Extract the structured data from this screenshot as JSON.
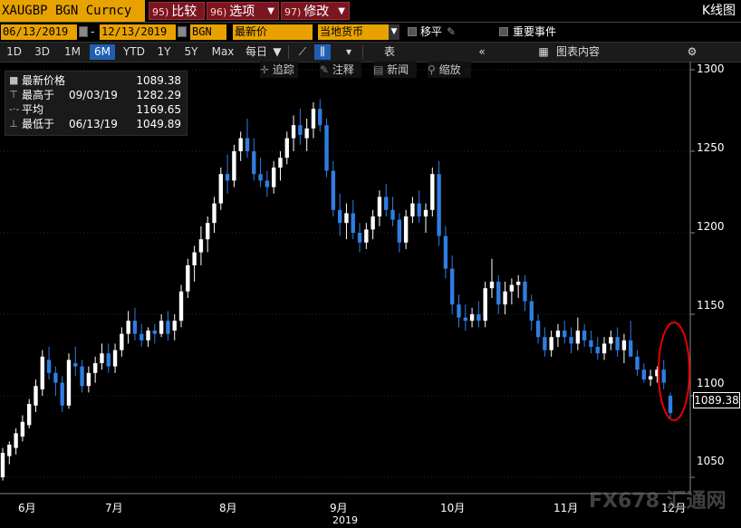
{
  "toolbar": {
    "ticker": "XAUGBP BGN Curncy",
    "menu": [
      {
        "num": "95)",
        "label": "比较"
      },
      {
        "num": "96)",
        "label": "选项"
      },
      {
        "num": "97)",
        "label": "修改"
      }
    ],
    "window_title": "K线图"
  },
  "controls": {
    "start_date": "06/13/2019",
    "end_date": "12/13/2019",
    "date_sep": "-",
    "source": "BGN",
    "price_field": "最新价",
    "currency": "当地货币",
    "move_label": "移平",
    "events_label": "重要事件"
  },
  "periods": {
    "items": [
      "1D",
      "3D",
      "1M",
      "6M",
      "YTD",
      "1Y",
      "5Y",
      "Max"
    ],
    "active": "6M",
    "interval": "每日",
    "table_label": "表",
    "chart_content_label": "图表内容"
  },
  "tools": [
    "追踪",
    "注释",
    "新闻",
    "缩放"
  ],
  "legend": {
    "rows": [
      {
        "icon": "square-icon",
        "label": "最新价格",
        "date": "",
        "value": "1089.38"
      },
      {
        "icon": "high-icon",
        "label": "最高于",
        "date": "09/03/19",
        "value": "1282.29"
      },
      {
        "icon": "avg-icon",
        "label": "平均",
        "date": "",
        "value": "1169.65"
      },
      {
        "icon": "low-icon",
        "label": "最低于",
        "date": "06/13/19",
        "value": "1049.89"
      }
    ]
  },
  "colors": {
    "up": "#ffffff",
    "down": "#2f7de1",
    "accent": "#e8a200",
    "menu": "#7a1620",
    "annotation": "#e60000"
  },
  "watermark": "FX678 汇通网",
  "chart_data": {
    "type": "candlestick",
    "x_labels": [
      "6月",
      "7月",
      "8月",
      "9月",
      "10月",
      "11月",
      "12月"
    ],
    "year_label": "2019",
    "y_ticks": [
      1050,
      1100,
      1150,
      1200,
      1250,
      1300
    ],
    "ylim": [
      1040,
      1305
    ],
    "last_price": "1089.38",
    "candles": [
      [
        1050,
        1068,
        1048,
        1065
      ],
      [
        1063,
        1072,
        1058,
        1070
      ],
      [
        1068,
        1080,
        1064,
        1077
      ],
      [
        1075,
        1088,
        1072,
        1084
      ],
      [
        1082,
        1098,
        1080,
        1095
      ],
      [
        1094,
        1110,
        1090,
        1106
      ],
      [
        1104,
        1128,
        1100,
        1124
      ],
      [
        1122,
        1130,
        1110,
        1114
      ],
      [
        1114,
        1118,
        1100,
        1108
      ],
      [
        1108,
        1112,
        1090,
        1094
      ],
      [
        1094,
        1126,
        1092,
        1122
      ],
      [
        1120,
        1130,
        1112,
        1118
      ],
      [
        1118,
        1122,
        1102,
        1106
      ],
      [
        1106,
        1118,
        1102,
        1114
      ],
      [
        1114,
        1124,
        1108,
        1120
      ],
      [
        1120,
        1132,
        1116,
        1126
      ],
      [
        1126,
        1132,
        1114,
        1118
      ],
      [
        1118,
        1132,
        1114,
        1128
      ],
      [
        1128,
        1142,
        1124,
        1138
      ],
      [
        1138,
        1152,
        1132,
        1146
      ],
      [
        1146,
        1154,
        1134,
        1138
      ],
      [
        1138,
        1144,
        1130,
        1134
      ],
      [
        1134,
        1142,
        1130,
        1140
      ],
      [
        1140,
        1144,
        1132,
        1138
      ],
      [
        1138,
        1150,
        1136,
        1146
      ],
      [
        1146,
        1152,
        1134,
        1138
      ],
      [
        1140,
        1150,
        1134,
        1146
      ],
      [
        1146,
        1168,
        1142,
        1164
      ],
      [
        1164,
        1184,
        1160,
        1180
      ],
      [
        1180,
        1192,
        1170,
        1188
      ],
      [
        1188,
        1204,
        1180,
        1196
      ],
      [
        1196,
        1210,
        1188,
        1206
      ],
      [
        1206,
        1222,
        1200,
        1218
      ],
      [
        1218,
        1240,
        1214,
        1236
      ],
      [
        1236,
        1248,
        1224,
        1232
      ],
      [
        1232,
        1254,
        1228,
        1250
      ],
      [
        1250,
        1262,
        1244,
        1258
      ],
      [
        1258,
        1270,
        1246,
        1250
      ],
      [
        1250,
        1258,
        1232,
        1236
      ],
      [
        1236,
        1246,
        1228,
        1232
      ],
      [
        1232,
        1238,
        1222,
        1228
      ],
      [
        1228,
        1244,
        1224,
        1240
      ],
      [
        1240,
        1250,
        1232,
        1246
      ],
      [
        1246,
        1262,
        1242,
        1258
      ],
      [
        1258,
        1272,
        1250,
        1266
      ],
      [
        1266,
        1276,
        1254,
        1260
      ],
      [
        1258,
        1270,
        1250,
        1264
      ],
      [
        1264,
        1280,
        1258,
        1276
      ],
      [
        1276,
        1282,
        1262,
        1266
      ],
      [
        1266,
        1270,
        1234,
        1238
      ],
      [
        1238,
        1244,
        1210,
        1214
      ],
      [
        1214,
        1224,
        1198,
        1206
      ],
      [
        1206,
        1218,
        1196,
        1212
      ],
      [
        1212,
        1220,
        1196,
        1200
      ],
      [
        1200,
        1206,
        1188,
        1194
      ],
      [
        1194,
        1206,
        1190,
        1202
      ],
      [
        1202,
        1214,
        1196,
        1210
      ],
      [
        1210,
        1226,
        1204,
        1222
      ],
      [
        1222,
        1230,
        1210,
        1214
      ],
      [
        1214,
        1222,
        1204,
        1208
      ],
      [
        1208,
        1212,
        1188,
        1194
      ],
      [
        1194,
        1214,
        1190,
        1210
      ],
      [
        1210,
        1222,
        1206,
        1218
      ],
      [
        1218,
        1226,
        1206,
        1210
      ],
      [
        1210,
        1218,
        1200,
        1214
      ],
      [
        1214,
        1240,
        1210,
        1236
      ],
      [
        1236,
        1244,
        1192,
        1198
      ],
      [
        1198,
        1204,
        1172,
        1178
      ],
      [
        1178,
        1186,
        1150,
        1156
      ],
      [
        1156,
        1162,
        1142,
        1148
      ],
      [
        1148,
        1156,
        1140,
        1146
      ],
      [
        1146,
        1154,
        1142,
        1150
      ],
      [
        1150,
        1158,
        1142,
        1146
      ],
      [
        1146,
        1170,
        1142,
        1166
      ],
      [
        1166,
        1184,
        1160,
        1170
      ],
      [
        1170,
        1174,
        1150,
        1156
      ],
      [
        1156,
        1170,
        1150,
        1164
      ],
      [
        1164,
        1172,
        1156,
        1168
      ],
      [
        1168,
        1174,
        1160,
        1170
      ],
      [
        1170,
        1174,
        1152,
        1158
      ],
      [
        1158,
        1162,
        1140,
        1146
      ],
      [
        1146,
        1150,
        1132,
        1136
      ],
      [
        1136,
        1142,
        1124,
        1128
      ],
      [
        1128,
        1140,
        1124,
        1136
      ],
      [
        1136,
        1144,
        1130,
        1140
      ],
      [
        1140,
        1146,
        1132,
        1136
      ],
      [
        1136,
        1142,
        1126,
        1132
      ],
      [
        1132,
        1148,
        1128,
        1140
      ],
      [
        1140,
        1144,
        1130,
        1134
      ],
      [
        1134,
        1140,
        1126,
        1130
      ],
      [
        1130,
        1136,
        1122,
        1126
      ],
      [
        1126,
        1136,
        1122,
        1132
      ],
      [
        1132,
        1140,
        1128,
        1136
      ],
      [
        1136,
        1142,
        1124,
        1128
      ],
      [
        1128,
        1138,
        1120,
        1134
      ],
      [
        1134,
        1146,
        1130,
        1124
      ],
      [
        1124,
        1128,
        1112,
        1116
      ],
      [
        1116,
        1120,
        1108,
        1110
      ],
      [
        1110,
        1116,
        1106,
        1112
      ],
      [
        1112,
        1118,
        1108,
        1116
      ],
      [
        1116,
        1122,
        1104,
        1108
      ],
      [
        1100,
        1102,
        1086,
        1089.38
      ]
    ]
  }
}
